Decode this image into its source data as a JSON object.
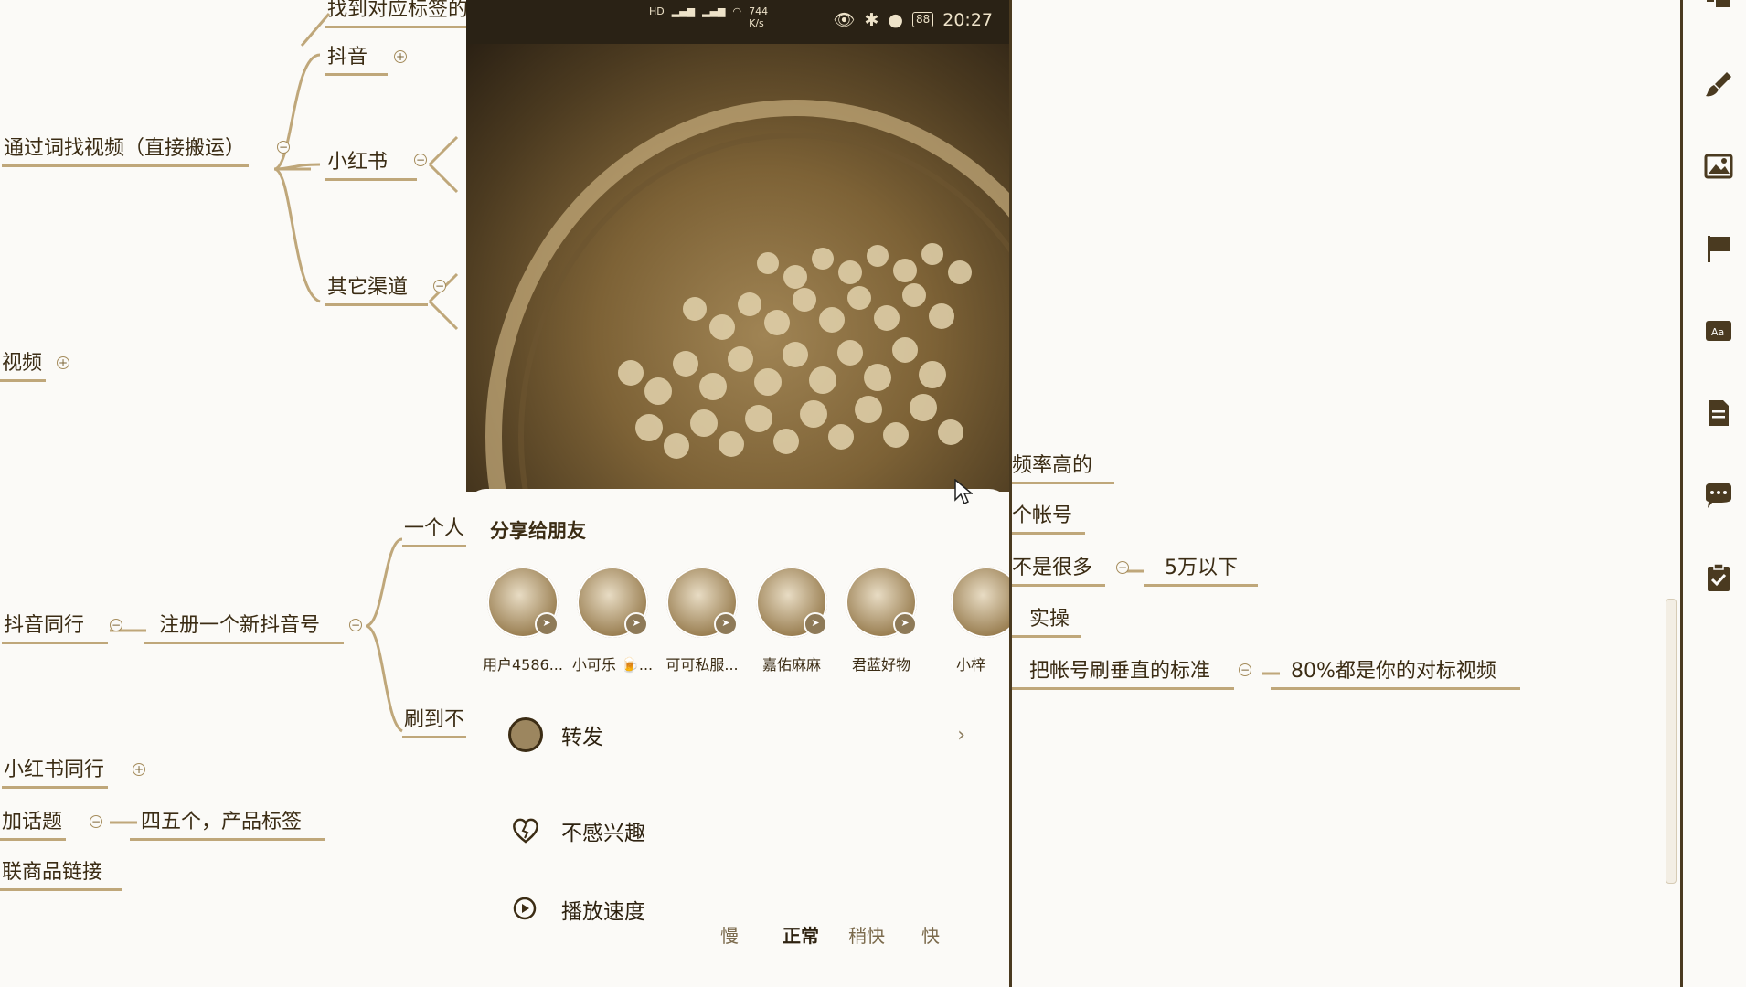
{
  "mindmap": {
    "nodes": {
      "find_tag": "找到对应标签的",
      "douyin": "抖音",
      "search_video": "通过词找视频（直接搬运）",
      "xiaohongshu": "小红书",
      "other_channels": "其它渠道",
      "video": "视频",
      "one_person": "一个人",
      "douyin_peers": "抖音同行",
      "register_new": "注册一个新抖音号",
      "scroll_to": "刷到不",
      "xhs_peers": "小红书同行",
      "add_topic": "加话题",
      "four_five_tags": "四五个，产品标签",
      "link_product": "联商品链接",
      "high_freq": "频率高的",
      "one_account": "个帐号",
      "not_many": "不是很多",
      "under_50k": "5万以下",
      "practice": "实操",
      "vertical_standard": "把帐号刷垂直的标准",
      "eighty_percent": "80%都是你的对标视频"
    }
  },
  "phone": {
    "status": {
      "speed": "744",
      "speed_unit": "K/s",
      "battery": "88",
      "time": "20:27"
    },
    "share_title": "分享给朋友",
    "friends": [
      {
        "name": "用户4586..."
      },
      {
        "name": "小可乐 🍺..."
      },
      {
        "name": "可可私服..."
      },
      {
        "name": "嘉佑麻麻"
      },
      {
        "name": "君蓝好物"
      },
      {
        "name": "小梓"
      }
    ],
    "forward_label": "转发",
    "not_interested_label": "不感兴趣",
    "playback_speed_label": "播放速度",
    "speed_options": [
      "慢",
      "正常",
      "稍快",
      "快"
    ],
    "selected_speed": "正常"
  },
  "toolbar": {
    "icons": [
      "structure-icon",
      "brush-icon",
      "image-icon",
      "flag-icon",
      "text-style-icon",
      "note-icon",
      "comment-icon",
      "clipboard-icon"
    ]
  }
}
